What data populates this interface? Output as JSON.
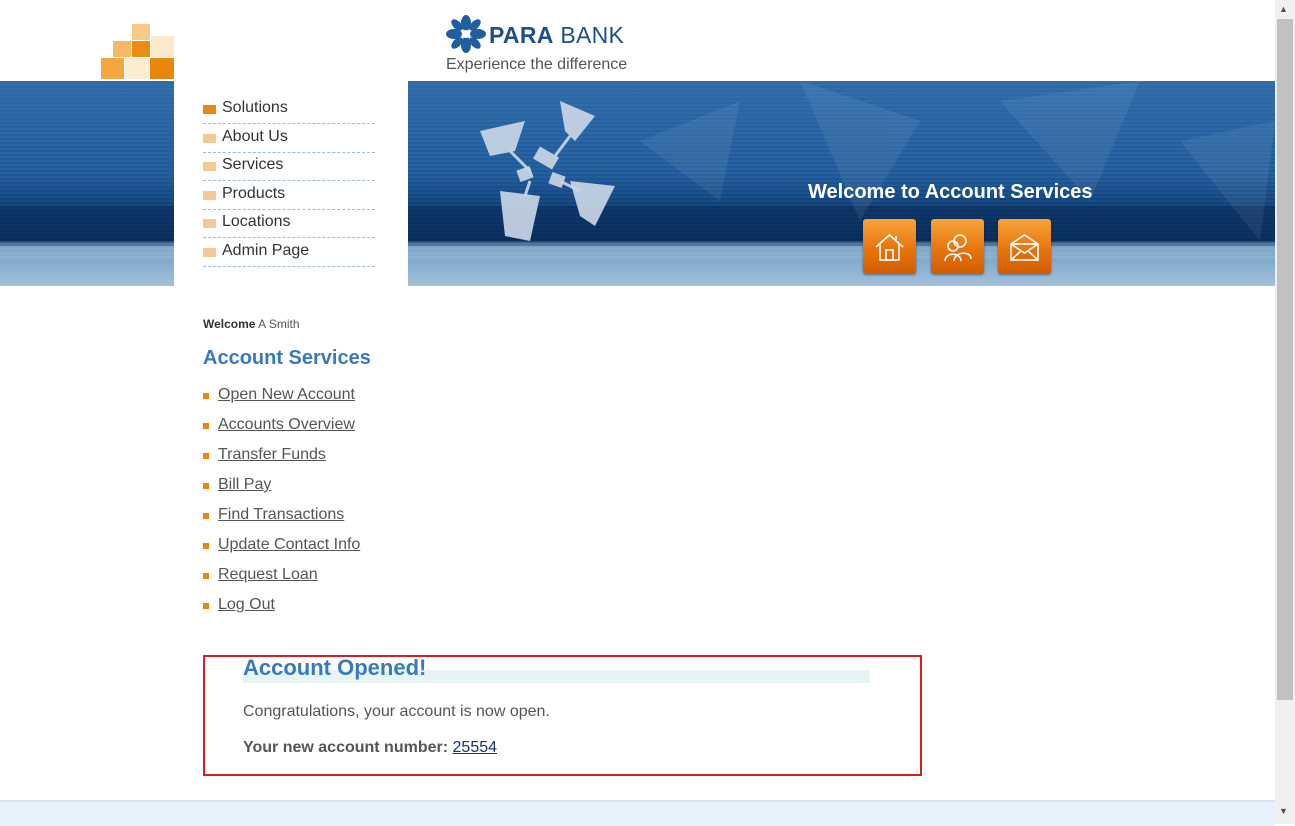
{
  "header": {
    "brand_bold": "PARA",
    "brand_rest": " BANK",
    "tagline": "Experience the difference",
    "welcome_title": "Welcome to Account Services",
    "icons": [
      "home-icon",
      "about-icon",
      "contact-icon"
    ]
  },
  "nav": {
    "items": [
      {
        "label": "Solutions",
        "active": true
      },
      {
        "label": "About Us"
      },
      {
        "label": "Services"
      },
      {
        "label": "Products"
      },
      {
        "label": "Locations"
      },
      {
        "label": "Admin Page"
      }
    ]
  },
  "sidebar": {
    "welcome_label": "Welcome",
    "user_name": "A Smith",
    "title": "Account Services",
    "links": [
      "Open New Account",
      "Accounts Overview",
      "Transfer Funds",
      "Bill Pay",
      "Find Transactions",
      "Update Contact Info",
      "Request Loan",
      "Log Out"
    ]
  },
  "result": {
    "title": "Account Opened!",
    "message": "Congratulations, your account is now open.",
    "account_label": "Your new account number:",
    "account_number": "25554"
  },
  "colors": {
    "accent_orange": "#e8870f",
    "title_blue": "#3a7ab8",
    "highlight_border": "#d62020"
  }
}
